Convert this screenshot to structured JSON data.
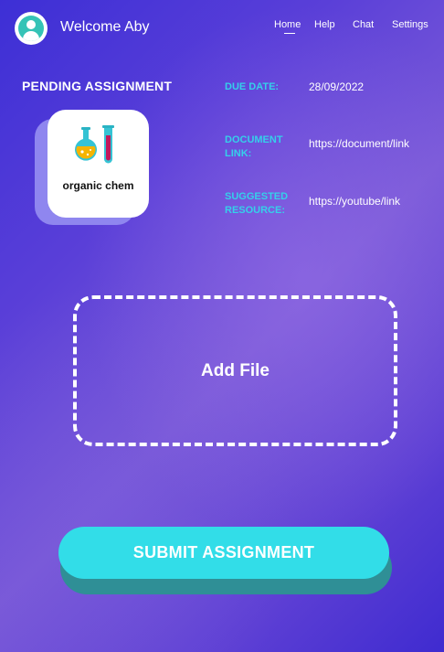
{
  "header": {
    "welcome": "Welcome Aby",
    "nav": [
      "Home",
      "Help",
      "Chat",
      "Settings"
    ]
  },
  "assignment": {
    "heading": "PENDING ASSIGNMENT",
    "subject": "organic chem",
    "icon": "chemistry-flask-icon",
    "due_date_label": "DUE DATE:",
    "due_date": "28/09/2022",
    "document_label_1": "DOCUMENT",
    "document_label_2": "LINK:",
    "document_link": "https://document/link",
    "resource_label_1": "SUGGESTED",
    "resource_label_2": "RESOURCE:",
    "resource_link": "https://youtube/link"
  },
  "upload": {
    "label": "Add File"
  },
  "submit": {
    "label": "SUBMIT ASSIGNMENT"
  },
  "colors": {
    "accent_cyan": "#32dde8",
    "label_cyan": "#35d0ea",
    "avatar_teal": "#35c3b6"
  }
}
